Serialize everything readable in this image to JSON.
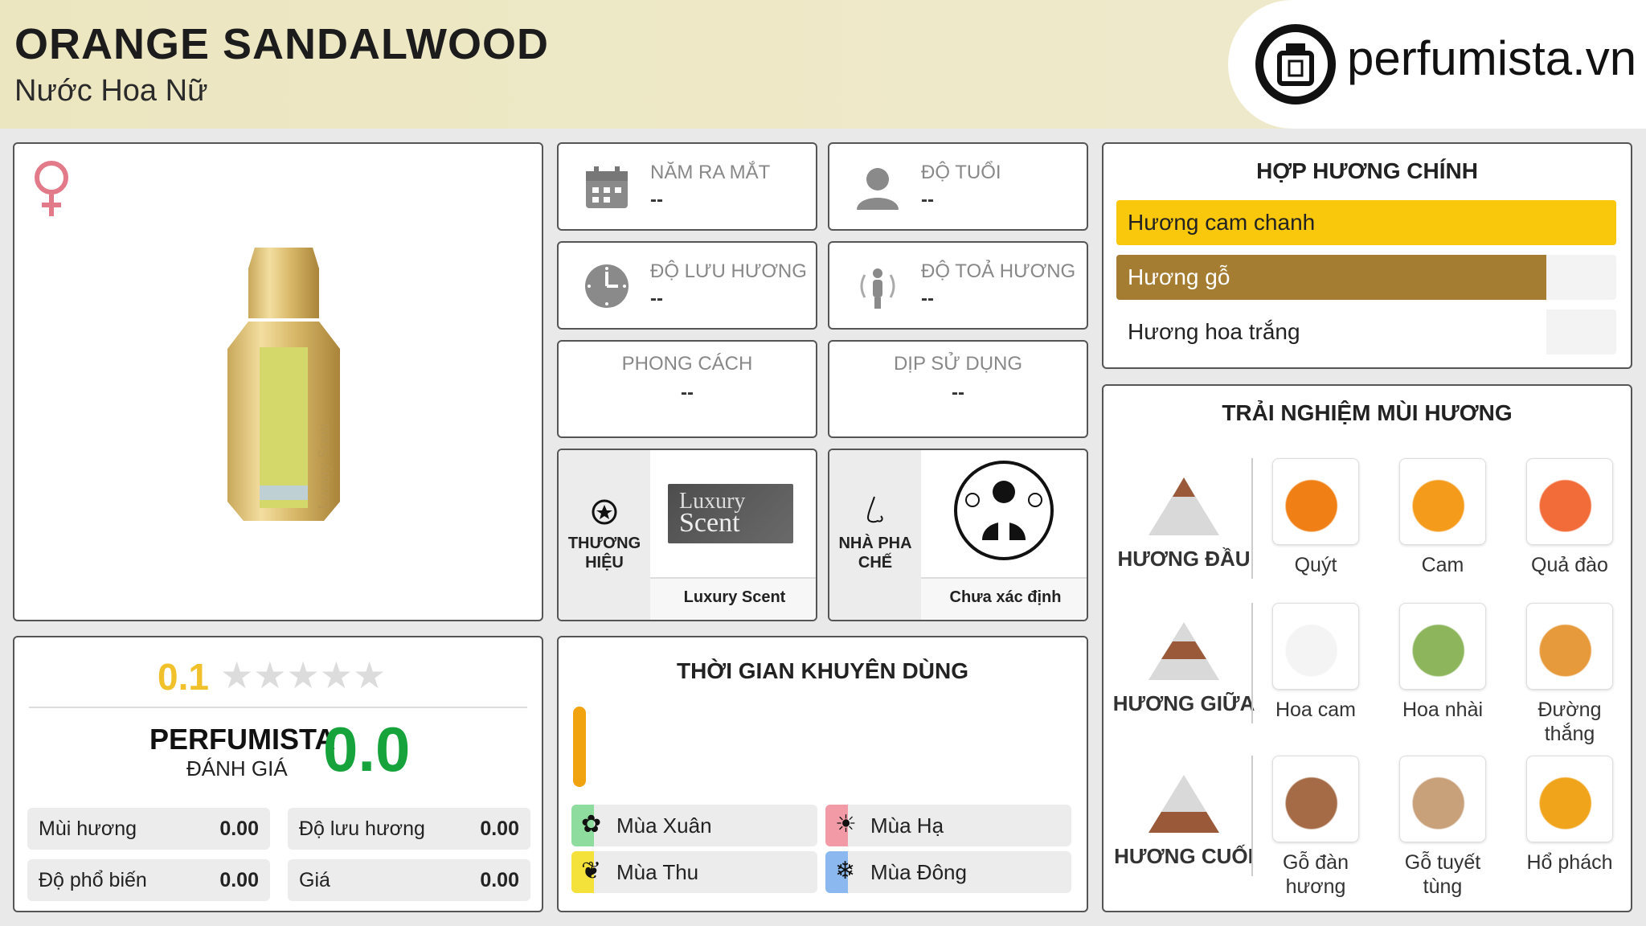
{
  "header": {
    "title": "ORANGE SANDALWOOD",
    "subtitle": "Nước Hoa Nữ",
    "logo_text": "perfumista.vn"
  },
  "product": {
    "gender_icon": "female-icon",
    "bottle_label": "Luxury Scent"
  },
  "info_cards": {
    "launch_year": {
      "label": "NĂM RA MẮT",
      "value": "--"
    },
    "age": {
      "label": "ĐỘ TUỔI",
      "value": "--"
    },
    "longevity": {
      "label": "ĐỘ LƯU HƯƠNG",
      "value": "--"
    },
    "sillage": {
      "label": "ĐỘ TOẢ HƯƠNG",
      "value": "--"
    },
    "style": {
      "label": "PHONG CÁCH",
      "value": "--"
    },
    "occasion": {
      "label": "DỊP SỬ DỤNG",
      "value": "--"
    }
  },
  "brand": {
    "label": "THƯƠNG HIỆU",
    "logo_line1": "Luxury",
    "logo_line2": "Scent",
    "name": "Luxury Scent"
  },
  "perfumer": {
    "label": "NHÀ PHA CHẾ",
    "name": "Chưa xác định"
  },
  "main_accords": {
    "title": "HỢP HƯƠNG CHÍNH",
    "items": [
      {
        "label": "Hương cam chanh",
        "level": 1.0,
        "color": "#f9c70c",
        "text_color": "#222"
      },
      {
        "label": "Hương gỗ",
        "level": 0.86,
        "color": "#a47d32",
        "text_color": "#fff"
      },
      {
        "label": "Hương hoa trắng",
        "level": 0.86,
        "color": "#ffffff",
        "text_color": "#222"
      }
    ]
  },
  "experience": {
    "title": "TRẢI NGHIỆM MÙI HƯƠNG",
    "tiers": [
      {
        "label": "HƯƠNG ĐẦU",
        "notes": [
          "Quýt",
          "Cam",
          "Quả đào"
        ]
      },
      {
        "label": "HƯƠNG GIỮA",
        "notes": [
          "Hoa cam",
          "Hoa nhài",
          "Đường thắng"
        ]
      },
      {
        "label": "HƯƠNG CUỐI",
        "notes": [
          "Gỗ đàn hương",
          "Gỗ tuyết tùng",
          "Hổ phách"
        ]
      }
    ]
  },
  "rating": {
    "score": "0.1",
    "stars_filled": 0,
    "stars_total": 5,
    "perfumista_label": "PERFUMISTA",
    "perfumista_sub": "ĐÁNH GIÁ",
    "perfumista_score": "0.0",
    "metrics": [
      {
        "label": "Mùi hương",
        "value": "0.00"
      },
      {
        "label": "Độ lưu hương",
        "value": "0.00"
      },
      {
        "label": "Độ phổ biến",
        "value": "0.00"
      },
      {
        "label": "Giá",
        "value": "0.00"
      }
    ]
  },
  "usage_time": {
    "title": "THỜI GIAN KHUYÊN DÙNG",
    "seasons": [
      {
        "label": "Mùa Xuân",
        "color": "#8fdc9f"
      },
      {
        "label": "Mùa Hạ",
        "color": "#f29aa6"
      },
      {
        "label": "Mùa Thu",
        "color": "#f4e23a"
      },
      {
        "label": "Mùa Đông",
        "color": "#8ab8ef"
      }
    ]
  }
}
